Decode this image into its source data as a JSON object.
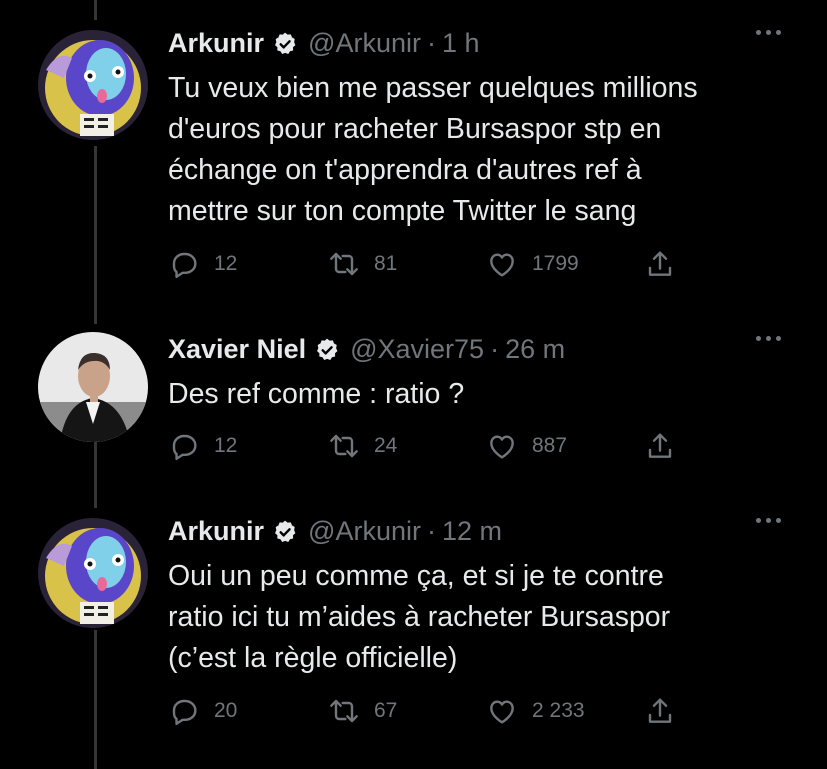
{
  "tweets": [
    {
      "name": "Arkunir",
      "handle": "@Arkunir",
      "time": "1 h",
      "lines": [
        "Tu veux bien me passer quelques millions",
        "d'euros pour racheter Bursaspor stp en",
        "échange on t'apprendra d'autres ref à",
        "mettre sur ton compte Twitter le sang"
      ],
      "replies": "12",
      "retweets": "81",
      "likes": "1799"
    },
    {
      "name": "Xavier Niel",
      "handle": "@Xavier75",
      "time": "26 m",
      "lines": [
        "Des ref comme : ratio ?"
      ],
      "replies": "12",
      "retweets": "24",
      "likes": "887"
    },
    {
      "name": "Arkunir",
      "handle": "@Arkunir",
      "time": "12 m",
      "lines": [
        "Oui un peu comme ça, et si je te contre",
        "ratio ici tu m’aides à racheter Bursaspor",
        "(c’est la règle officielle)"
      ],
      "replies": "20",
      "retweets": "67",
      "likes": "2 233"
    }
  ],
  "separator": "·",
  "icons": [
    "verified-badge-icon",
    "more-icon",
    "reply-icon",
    "retweet-icon",
    "like-icon",
    "share-icon"
  ],
  "colors": {
    "background": "#000000",
    "text": "#e7e9ea",
    "muted": "#71767b",
    "thread_line": "#333639"
  }
}
